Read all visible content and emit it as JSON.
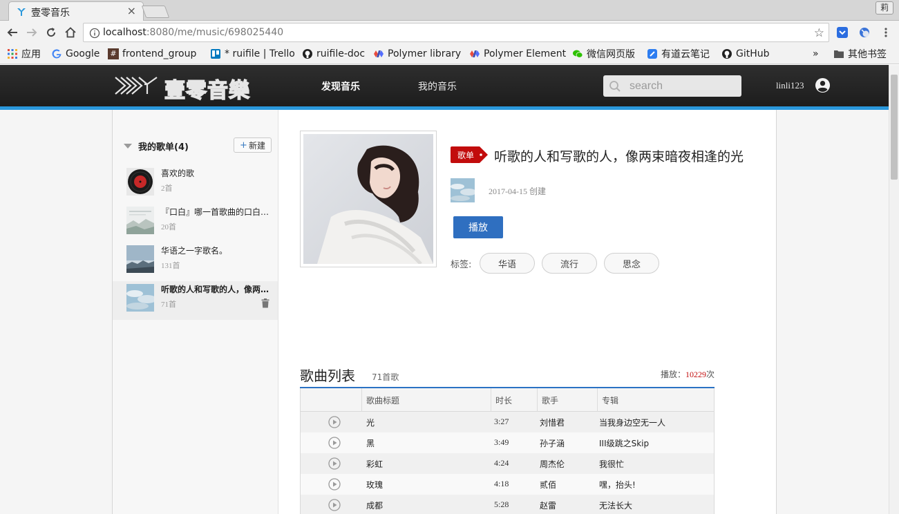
{
  "browser": {
    "tab_title": "壹零音乐",
    "tab_close": "×",
    "profile_label": "莉",
    "url_host": "localhost",
    "url_rest": ":8080/me/music/698025440",
    "bookmarks": {
      "apps": "应用",
      "google": "Google",
      "frontend": "frontend_group",
      "trello": "* ruifile | Trello",
      "ruifile_doc": "ruifile-doc",
      "polymer_library": "Polymer library",
      "polymer_element": "Polymer Element",
      "wechat": "微信网页版",
      "youdao": "有道云笔记",
      "github": "GitHub",
      "more": "»",
      "other": "其他书签"
    }
  },
  "site": {
    "logo_text": "壹零音樂",
    "nav": {
      "discover": "发现音乐",
      "my_music": "我的音乐"
    },
    "search_placeholder": "search",
    "username": "linli123"
  },
  "sidebar": {
    "title": "我的歌单(4)",
    "new_button": "新建",
    "new_plus": "+",
    "playlists": [
      {
        "name": "喜欢的歌",
        "count": "2首"
      },
      {
        "name": "『口白』哪一首歌曲的口白让你印象最深",
        "count": "20首"
      },
      {
        "name": "华语之一字歌名。",
        "count": "131首"
      },
      {
        "name": "听歌的人和写歌的人，像两束暗夜相逢的光",
        "count": "71首"
      }
    ]
  },
  "detail": {
    "type_badge": "歌单",
    "title": "听歌的人和写歌的人，像两束暗夜相逢的光",
    "created_date": "2017-04-15",
    "created_suffix": "创建",
    "play_button": "播放",
    "tags_label": "标签:",
    "tags": [
      "华语",
      "流行",
      "思念"
    ]
  },
  "song_list": {
    "title": "歌曲列表",
    "count": "71首歌",
    "plays_label": "播放：",
    "plays_value": "10229",
    "plays_unit": "次",
    "columns": {
      "title": "歌曲标题",
      "duration": "时长",
      "artist": "歌手",
      "album": "专辑"
    },
    "songs": [
      {
        "title": "光",
        "duration": "3:27",
        "artist": "刘惜君",
        "album": "当我身边空无一人"
      },
      {
        "title": "黑",
        "duration": "3:49",
        "artist": "孙子涵",
        "album": "III级跳之Skip"
      },
      {
        "title": "彩虹",
        "duration": "4:24",
        "artist": "周杰伦",
        "album": "我很忙"
      },
      {
        "title": "玫瑰",
        "duration": "4:18",
        "artist": "贰佰",
        "album": "嘿，抬头!"
      },
      {
        "title": "成都",
        "duration": "5:28",
        "artist": "赵雷",
        "album": "无法长大"
      }
    ]
  },
  "colors": {
    "accent_blue": "#2a98dc",
    "play_button": "#2f6fc0",
    "badge_red": "#c20c0c",
    "header_dark": "#242424"
  }
}
